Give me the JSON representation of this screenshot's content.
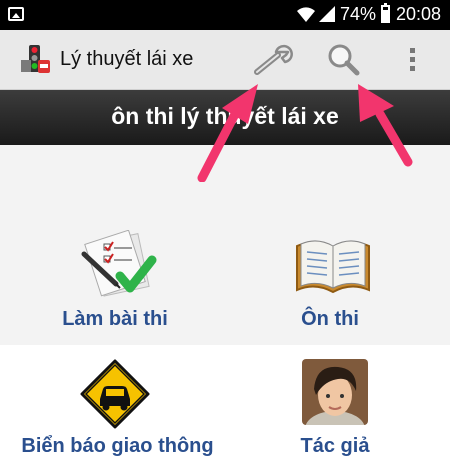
{
  "status_bar": {
    "battery": "74%",
    "time": "20:08"
  },
  "app": {
    "title": "Lý thuyết lái xe"
  },
  "header": {
    "title": "ôn thi lý thuyết lái xe"
  },
  "menu": [
    {
      "label": "Làm bài thi",
      "icon": "exam-checklist-icon"
    },
    {
      "label": "Ôn thi",
      "icon": "open-book-icon"
    },
    {
      "label": "Biển báo giao thông",
      "icon": "traffic-sign-car-icon"
    },
    {
      "label": "Tác giả",
      "icon": "author-photo-icon"
    }
  ],
  "colors": {
    "accent_label": "#2a4f8e",
    "arrow": "#f2356d",
    "sign": "#f6c200"
  }
}
